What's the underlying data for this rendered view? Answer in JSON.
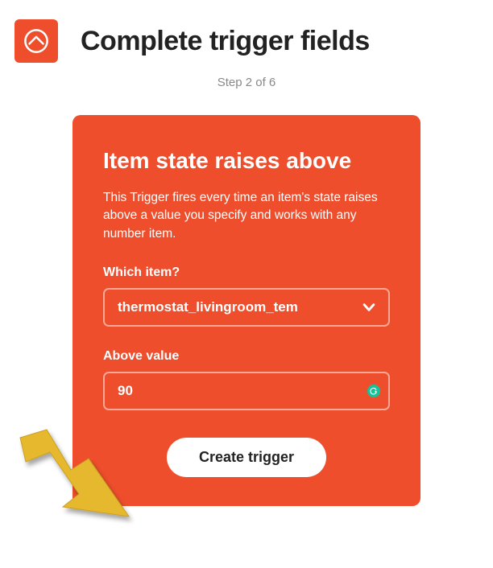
{
  "header": {
    "title": "Complete trigger fields",
    "step_text": "Step 2 of 6",
    "service_icon": "openhab-icon"
  },
  "card": {
    "title": "Item state raises above",
    "description": "This Trigger fires every time an item's state raises above a value you specify and works with any number item.",
    "field1": {
      "label": "Which item?",
      "selected": "thermostat_livingroom_tem"
    },
    "field2": {
      "label": "Above value",
      "value": "90"
    },
    "submit_label": "Create trigger"
  },
  "colors": {
    "accent": "#ee4e2c",
    "arrow": "#e6b82e"
  }
}
